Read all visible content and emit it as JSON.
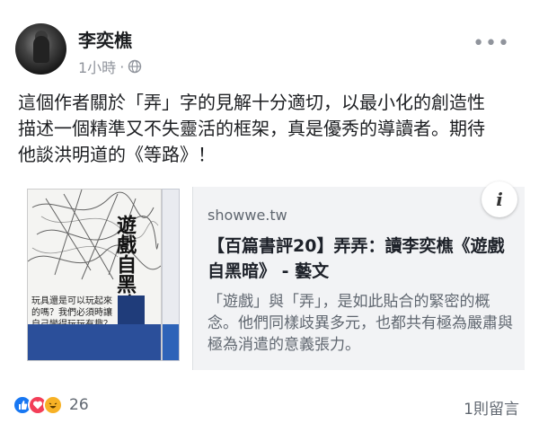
{
  "post": {
    "author": "李奕樵",
    "time": "1小時",
    "dot": "·",
    "body": "這個作者關於「弄」字的見解十分適切，以最小化的創造性\n描述一個精準又不失靈活的框架，真是優秀的導讀者。期待\n他談洪明道的《等路》！"
  },
  "link": {
    "domain": "showwe.tw",
    "title": "【百篇書評20】弄弄：讀李奕樵《遊戲自黑暗》 - 藝文",
    "description": "「遊戲」與「弄」，是如此貼合的緊密的概念。他們同樣歧異多元，也都共有極為嚴肅與極為消遣的意義張力。",
    "info_label": "i",
    "book": {
      "title": "遊戲自黑暗",
      "cover_text": "玩具還是可以玩起來的嗎？我們必須時讓自己變得玩玩有趣？"
    }
  },
  "footer": {
    "reaction_count": "26",
    "comments_label": "1則留言"
  },
  "icons": {
    "more": "more-horizontal-icon",
    "globe": "globe-icon",
    "like": "like-icon",
    "love": "love-icon",
    "haha": "haha-icon"
  }
}
